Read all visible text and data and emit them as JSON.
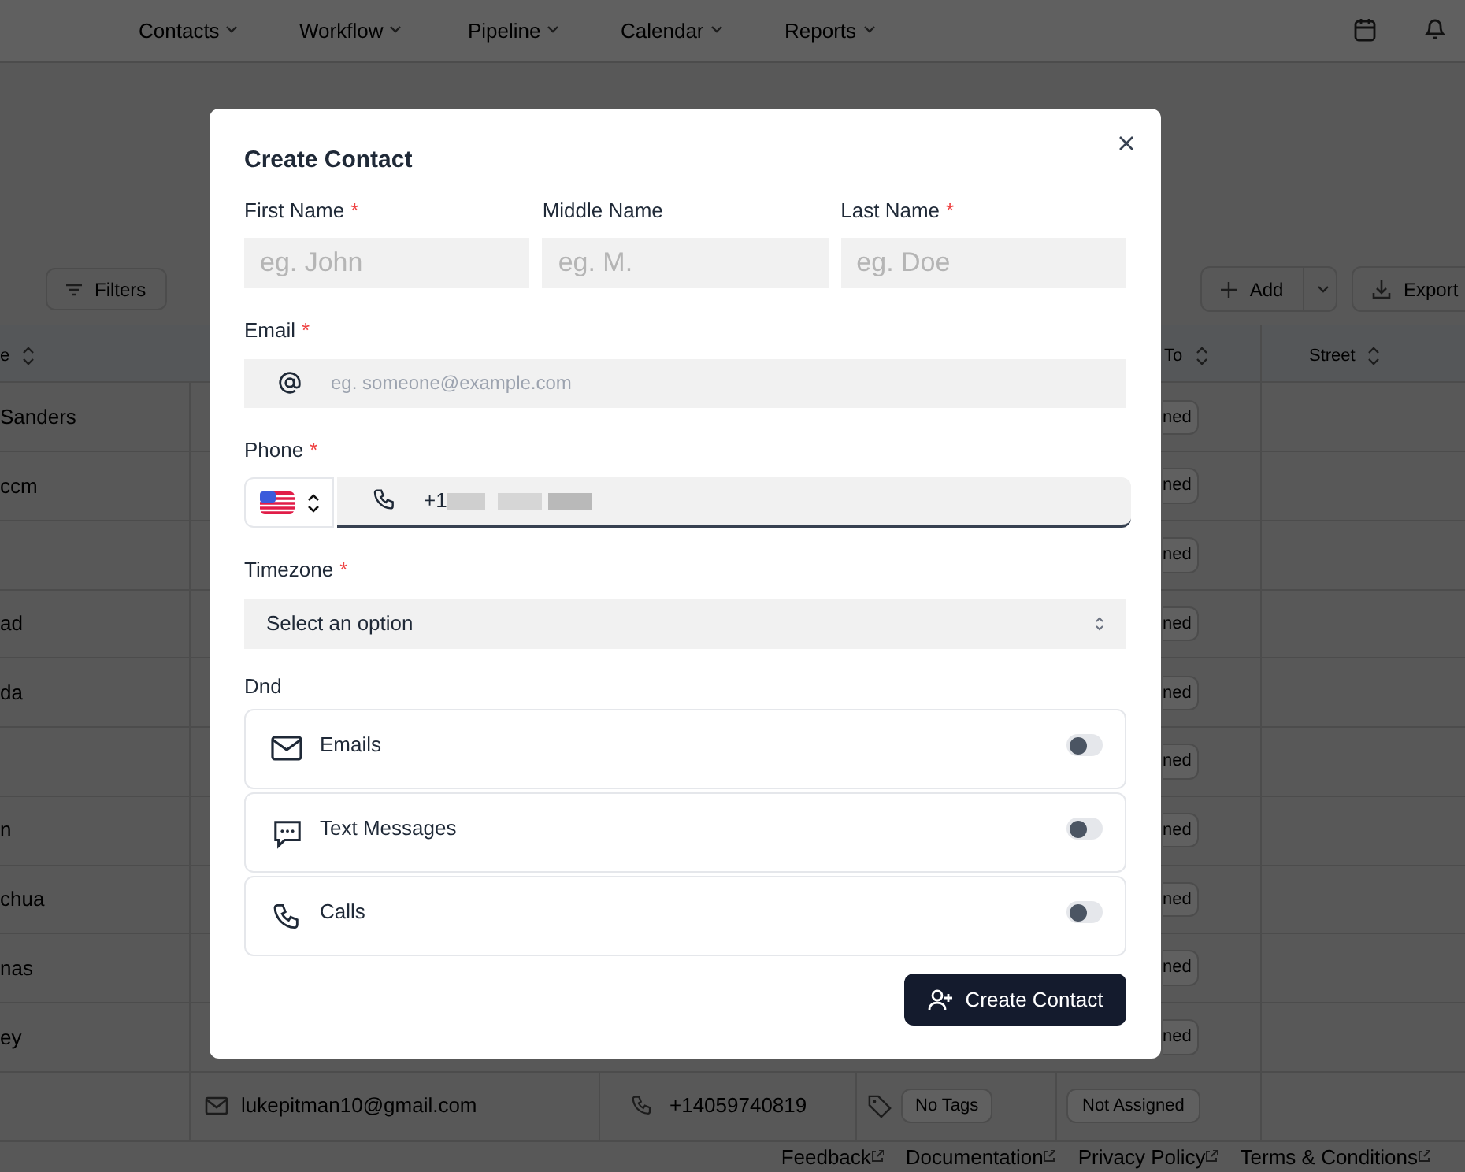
{
  "nav": [
    {
      "label": "Contacts"
    },
    {
      "label": "Workflow"
    },
    {
      "label": "Pipeline"
    },
    {
      "label": "Calendar"
    },
    {
      "label": "Reports"
    }
  ],
  "toolbar": {
    "filters": "Filters",
    "add": "Add",
    "export": "Export"
  },
  "table": {
    "columns": [
      {
        "label": "e"
      },
      {
        "label": "To"
      },
      {
        "label": "Street"
      }
    ],
    "rows": [
      {
        "name": "Sanders",
        "assigned": "ned"
      },
      {
        "name": "ccm",
        "assigned": "ned"
      },
      {
        "name": "",
        "assigned": "ned"
      },
      {
        "name": "ad",
        "assigned": "ned"
      },
      {
        "name": "da",
        "assigned": "ned"
      },
      {
        "name": "",
        "assigned": "ned"
      },
      {
        "name": "n",
        "assigned": "ned"
      },
      {
        "name": "chua",
        "assigned": "ned"
      },
      {
        "name": "nas",
        "assigned": "ned"
      },
      {
        "name": "ey",
        "assigned": "ned"
      }
    ],
    "last_row": {
      "email": "lukepitman10@gmail.com",
      "phone": "+14059740819",
      "tags": "No Tags",
      "assigned": "Not Assigned"
    }
  },
  "footer": [
    {
      "label": "Feedback"
    },
    {
      "label": "Documentation"
    },
    {
      "label": "Privacy Policy"
    },
    {
      "label": "Terms & Conditions"
    }
  ],
  "modal": {
    "title": "Create Contact",
    "name_fields": [
      {
        "label": "First Name",
        "required_mark": "*",
        "placeholder": "eg. John"
      },
      {
        "label": "Middle Name",
        "placeholder": "eg. M."
      },
      {
        "label": "Last Name",
        "required_mark": "*",
        "placeholder": "eg. Doe"
      }
    ],
    "email": {
      "label": "Email",
      "required_mark": "*",
      "placeholder": "eg. someone@example.com"
    },
    "phone": {
      "label": "Phone",
      "required_mark": "*",
      "value": "+1"
    },
    "timezone": {
      "label": "Timezone",
      "required_mark": "*",
      "value": "Select an option"
    },
    "dnd": {
      "label": "Dnd",
      "options": [
        {
          "kind": "email",
          "label": "Emails",
          "on": false
        },
        {
          "kind": "sms",
          "label": "Text Messages",
          "on": false
        },
        {
          "kind": "call",
          "label": "Calls",
          "on": false
        }
      ]
    },
    "submit": "Create Contact"
  }
}
